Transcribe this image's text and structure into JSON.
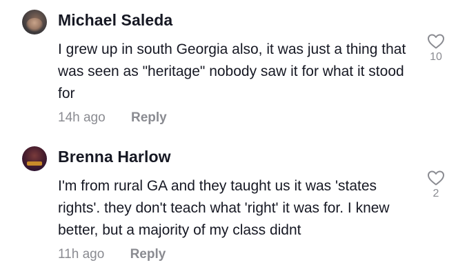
{
  "comments": [
    {
      "username": "Michael Saleda",
      "text": "I grew up in south Georgia also, it was just a thing that was seen as \"heritage\" nobody saw it for what it stood for",
      "time": "14h ago",
      "reply_label": "Reply",
      "like_count": "10",
      "like_icon": "heart-outline-icon"
    },
    {
      "username": "Brenna Harlow",
      "text": "I'm from rural GA and they taught us it was 'states rights'. they don't teach what 'right' it was for. I knew better, but a majority of my class didnt",
      "time": "11h ago",
      "reply_label": "Reply",
      "like_count": "2",
      "like_icon": "heart-outline-icon"
    }
  ],
  "colors": {
    "text_primary": "#161823",
    "text_secondary": "#8a8b91",
    "background": "#ffffff"
  }
}
